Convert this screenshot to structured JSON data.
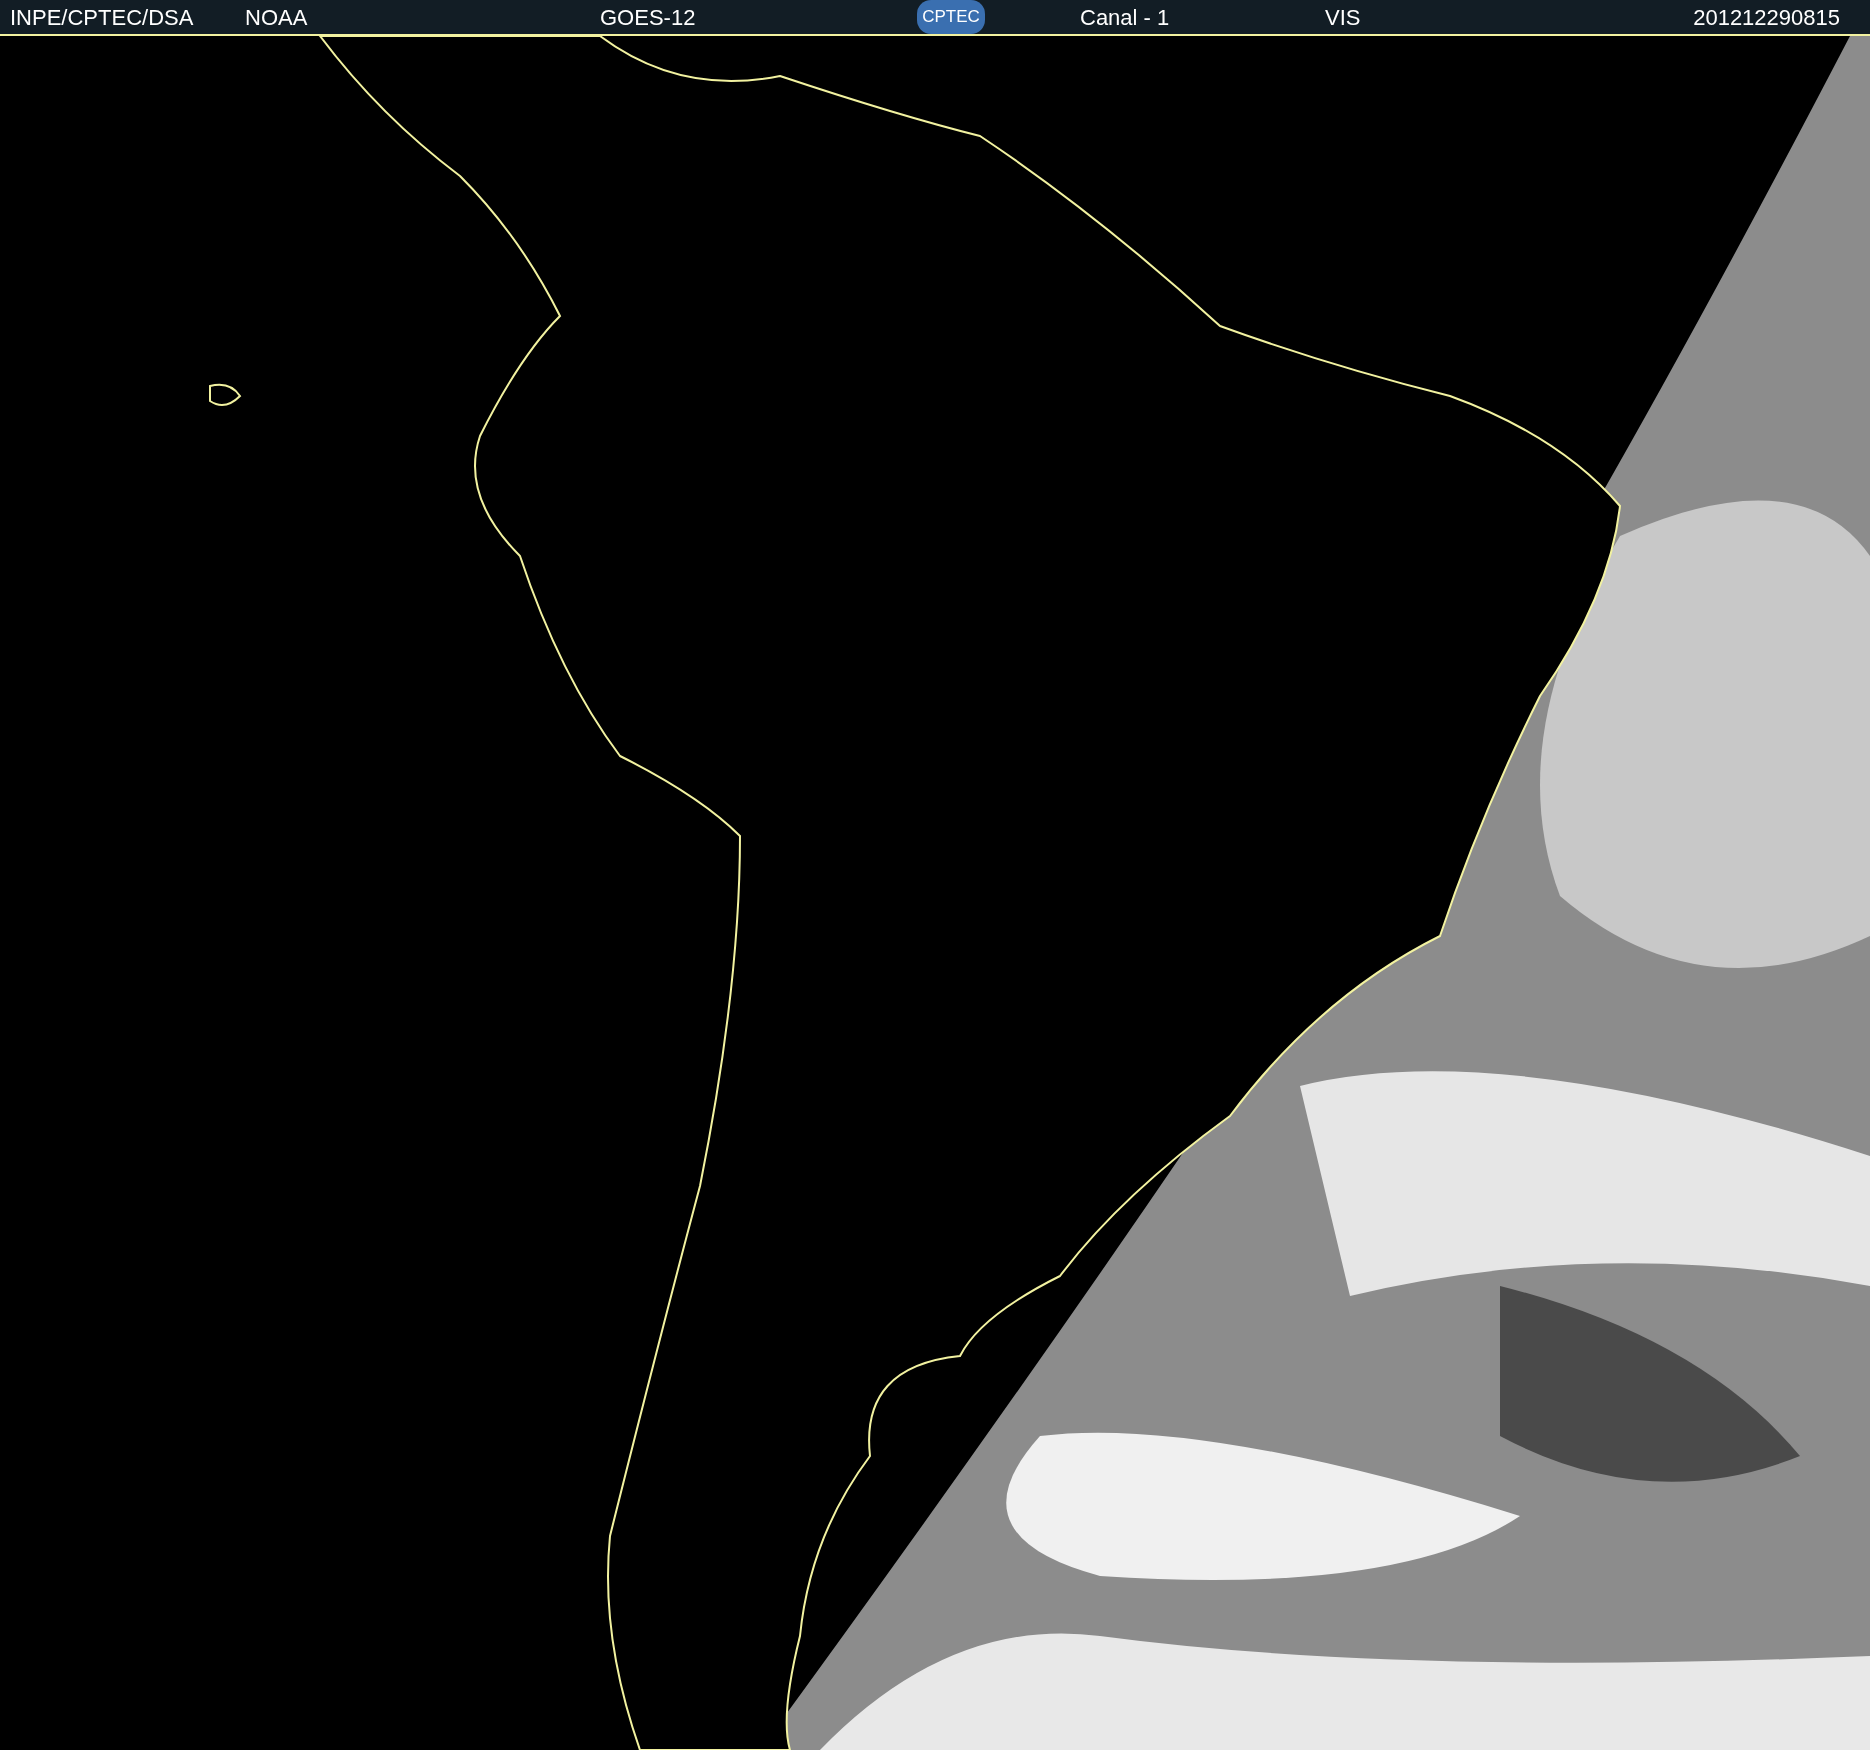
{
  "header": {
    "source": "INPE/CPTEC/DSA",
    "agency": "NOAA",
    "satellite": "GOES-12",
    "logo_text": "CPTEC",
    "channel": "Canal - 1",
    "band": "VIS",
    "timestamp": "201212290815"
  }
}
